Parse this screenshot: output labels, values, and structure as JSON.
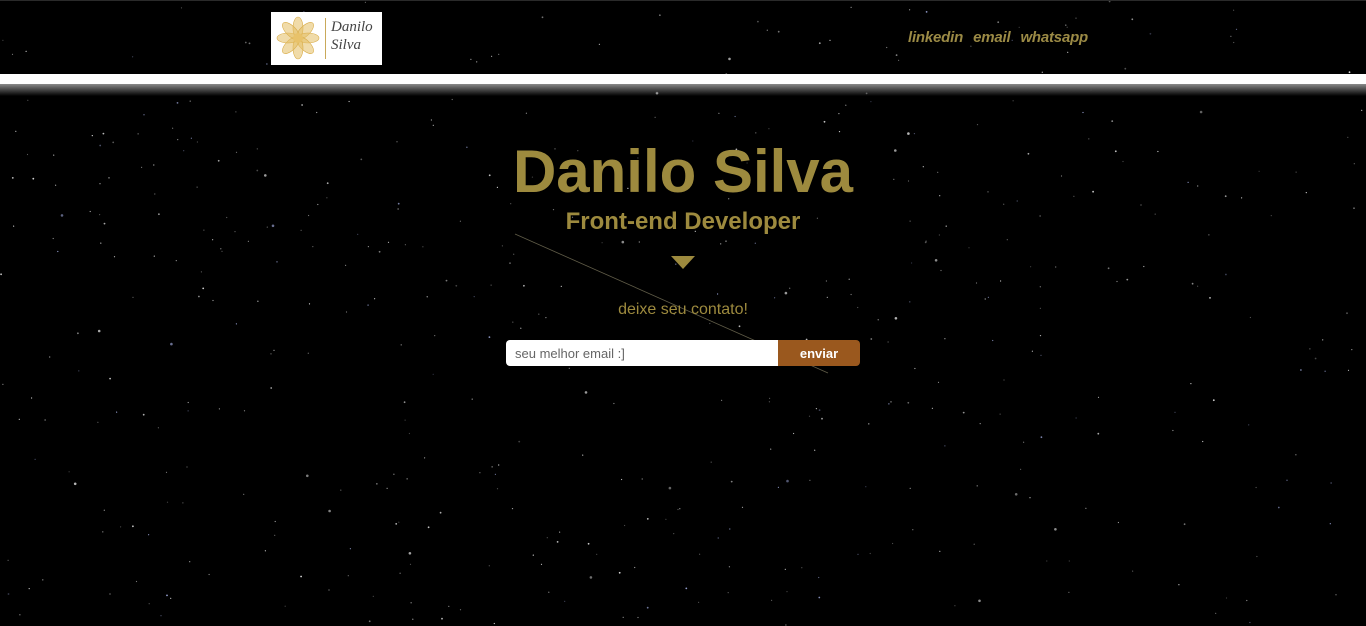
{
  "header": {
    "logo_text": "Danilo\nSilva",
    "nav": [
      {
        "label": "linkedin"
      },
      {
        "label": "email"
      },
      {
        "label": "whatsapp"
      }
    ]
  },
  "hero": {
    "title": "Danilo Silva",
    "subtitle": "Front-end Developer"
  },
  "contact": {
    "label": "deixe seu contato!",
    "email_placeholder": "seu melhor email :]",
    "email_value": "",
    "submit_label": "enviar"
  },
  "colors": {
    "accent_gold": "#9d8a3e",
    "button_brown": "#9a581e",
    "background": "#000000"
  },
  "icons": {
    "scroll_down": "chevron-down-icon",
    "logo": "flower-logo-icon"
  }
}
